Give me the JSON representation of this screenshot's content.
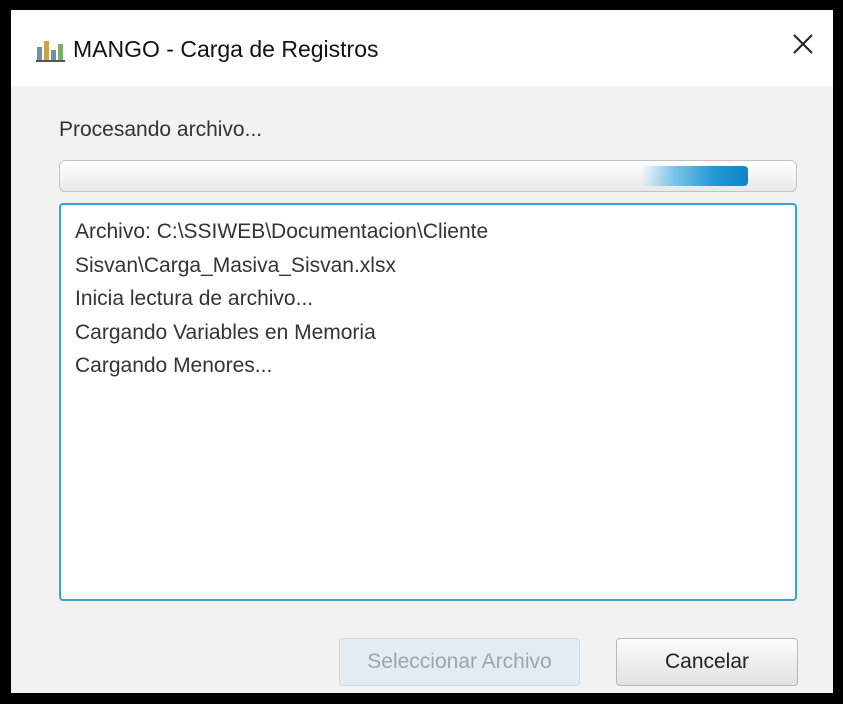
{
  "window": {
    "title": "MANGO - Carga de Registros",
    "icon": "bar-chart-icon",
    "close_icon": "close-icon"
  },
  "status": {
    "label": "Procesando archivo..."
  },
  "progress": {
    "mode": "indeterminate",
    "indicator_start_fraction": 0.79,
    "indicator_end_fraction": 0.935,
    "fill_color": "#0b86c9"
  },
  "log": {
    "lines": [
      "Archivo: C:\\SSIWEB\\Documentacion\\Cliente",
      "Sisvan\\Carga_Masiva_Sisvan.xlsx",
      "Inicia lectura de archivo...",
      "Cargando Variables en Memoria",
      "Cargando Menores..."
    ]
  },
  "buttons": {
    "select_file": {
      "label": "Seleccionar Archivo",
      "enabled": false
    },
    "cancel": {
      "label": "Cancelar",
      "enabled": true
    }
  },
  "colors": {
    "accent": "#3b9fd8",
    "background": "#f2f2f2"
  }
}
